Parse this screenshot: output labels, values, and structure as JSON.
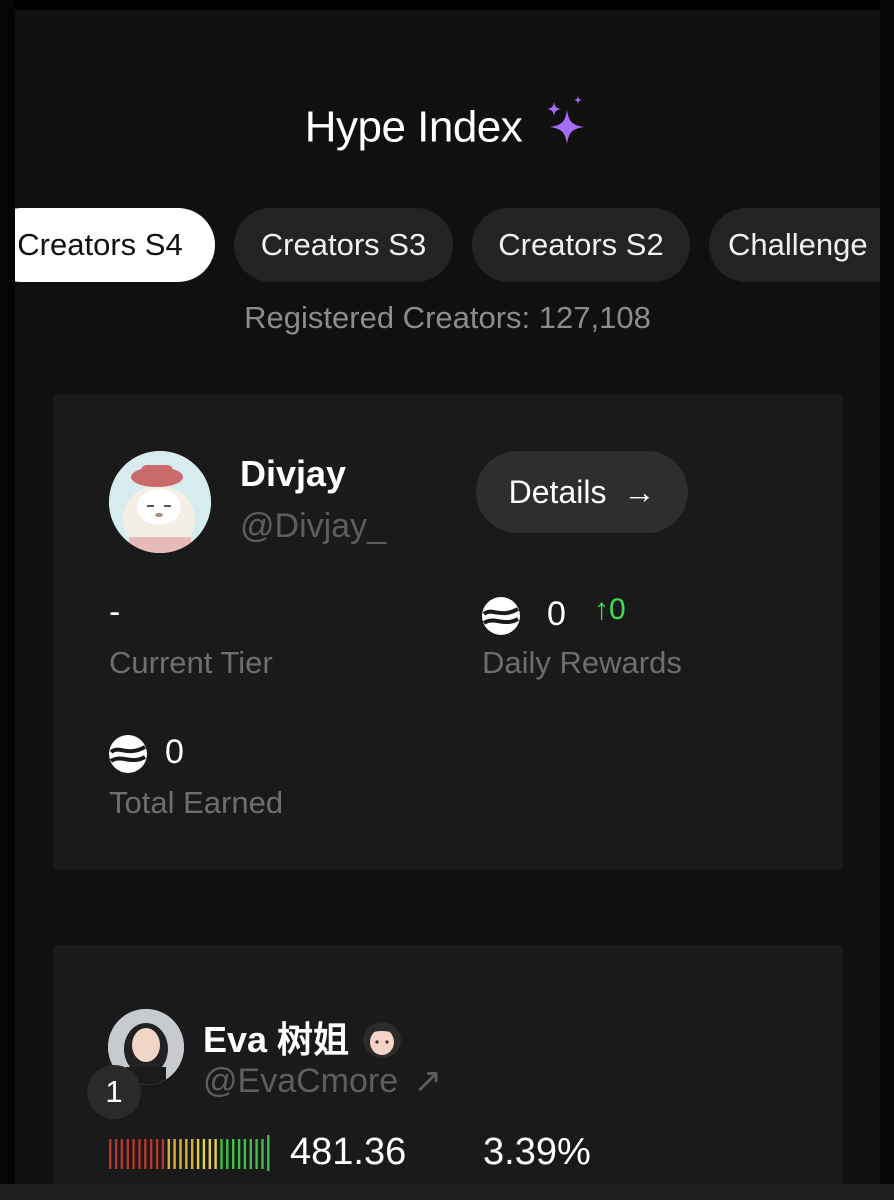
{
  "header": {
    "title": "Hype Index",
    "title_icon": "sparkles-icon"
  },
  "tabs": [
    {
      "label": "Creators S4",
      "active": true
    },
    {
      "label": "Creators S3",
      "active": false
    },
    {
      "label": "Creators S2",
      "active": false
    },
    {
      "label": "Challenge",
      "active": false
    }
  ],
  "registered_creators_text": "Registered Creators: 127,108",
  "my_card": {
    "name": "Divjay",
    "handle": "@Divjay_",
    "details_label": "Details",
    "details_arrow": "→",
    "current_tier_value": "-",
    "current_tier_label": "Current Tier",
    "daily_rewards_value": "0",
    "daily_rewards_change": "↑0",
    "daily_rewards_label": "Daily Rewards",
    "total_earned_value": "0",
    "total_earned_label": "Total Earned"
  },
  "leaderboard": [
    {
      "rank": "1",
      "name": "Eva 树姐",
      "name_emoji": "woman-emoji",
      "handle": "@EvaCmore",
      "external_arrow": "↗",
      "score": "481.36",
      "percent": "3.39%"
    }
  ],
  "colors": {
    "background": "#101010",
    "card": "#1a1a1a",
    "accent_purple": "#a66cf5",
    "positive_green": "#3ddc5a",
    "muted_text": "#6e6e6e"
  }
}
